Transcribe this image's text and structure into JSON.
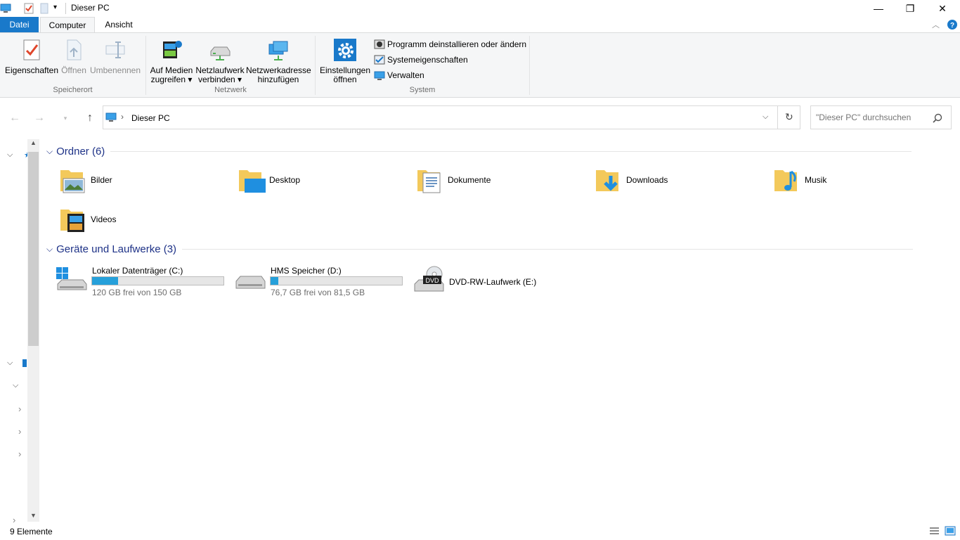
{
  "window": {
    "title": "Dieser PC",
    "minimize": "—",
    "restore": "❐",
    "close": "✕"
  },
  "tabs": [
    {
      "label": "Datei"
    },
    {
      "label": "Computer"
    },
    {
      "label": "Ansicht"
    }
  ],
  "ribbon": {
    "location_group": {
      "label": "Speicherort",
      "properties": "Eigenschaften",
      "open": "Öffnen",
      "rename": "Umbenennen"
    },
    "network_group": {
      "label": "Netzwerk",
      "media_line1": "Auf Medien",
      "media_line2": "zugreifen ▾",
      "drive_line1": "Netzlaufwerk",
      "drive_line2": "verbinden ▾",
      "addr_line1": "Netzwerkadresse",
      "addr_line2": "hinzufügen"
    },
    "system_group": {
      "label": "System",
      "settings_line1": "Einstellungen",
      "settings_line2": "öffnen",
      "uninstall": "Programm deinstallieren oder ändern",
      "sysprops": "Systemeigenschaften",
      "manage": "Verwalten"
    }
  },
  "address": {
    "crumb": "Dieser PC",
    "search_placeholder": "\"Dieser PC\" durchsuchen"
  },
  "folders_section": {
    "title": "Ordner (6)",
    "items": [
      {
        "name": "Bilder"
      },
      {
        "name": "Desktop"
      },
      {
        "name": "Dokumente"
      },
      {
        "name": "Downloads"
      },
      {
        "name": "Musik"
      },
      {
        "name": "Videos"
      }
    ]
  },
  "drives_section": {
    "title": "Geräte und Laufwerke (3)",
    "items": [
      {
        "name": "Lokaler Datenträger (C:)",
        "free": "120 GB frei von 150 GB",
        "used_fraction": 0.2
      },
      {
        "name": "HMS Speicher (D:)",
        "free": "76,7 GB frei von 81,5 GB",
        "used_fraction": 0.06
      },
      {
        "name": "DVD-RW-Laufwerk (E:)",
        "dvd_label": "DVD"
      }
    ]
  },
  "status": {
    "count": "9 Elemente"
  },
  "colors": {
    "accent": "#1979ca",
    "bar_fill": "#26a0da",
    "section_title": "#1e3287"
  }
}
